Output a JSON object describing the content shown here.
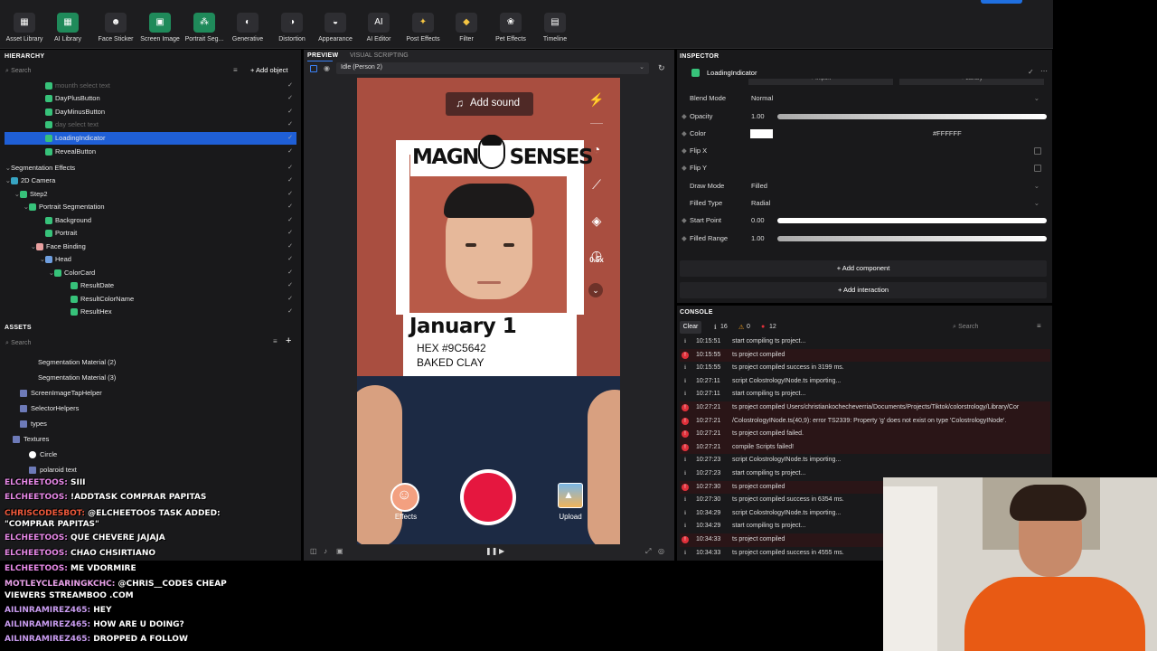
{
  "toolbar": {
    "items": [
      {
        "label": "Asset Library",
        "icon": "folder-icon"
      },
      {
        "label": "AI Library",
        "icon": "grid-icon"
      },
      {
        "label": "Face Sticker",
        "icon": "face-sticker-icon"
      },
      {
        "label": "Screen Image",
        "icon": "image-icon"
      },
      {
        "label": "Portrait Seg...",
        "icon": "portrait-icon"
      },
      {
        "label": "Generative",
        "icon": "generative-icon"
      },
      {
        "label": "Distortion",
        "icon": "distortion-icon"
      },
      {
        "label": "Appearance",
        "icon": "appearance-icon"
      },
      {
        "label": "AI Editor",
        "icon": "ai-editor-icon"
      },
      {
        "label": "Post Effects",
        "icon": "sparkle-icon"
      },
      {
        "label": "Filter",
        "icon": "filter-icon"
      },
      {
        "label": "Pet Effects",
        "icon": "paw-icon"
      },
      {
        "label": "Timeline",
        "icon": "timeline-icon"
      }
    ]
  },
  "hierarchy": {
    "title": "HIERARCHY",
    "search_placeholder": "Search",
    "add_object": "+ Add object",
    "rows": [
      {
        "label": "mounth select text",
        "dim": true
      },
      {
        "label": "DayPlusButton"
      },
      {
        "label": "DayMinusButton"
      },
      {
        "label": "day select text",
        "dim": true
      },
      {
        "label": "LoadingIndicator",
        "selected": true
      },
      {
        "label": "RevealButton"
      },
      {
        "label": "Segmentation Effects"
      },
      {
        "label": "2D Camera"
      },
      {
        "label": "Step2"
      },
      {
        "label": "Portrait Segmentation"
      },
      {
        "label": "Background"
      },
      {
        "label": "Portrait"
      },
      {
        "label": "Face Binding"
      },
      {
        "label": "Head"
      },
      {
        "label": "ColorCard"
      },
      {
        "label": "ResultDate"
      },
      {
        "label": "ResultColorName"
      },
      {
        "label": "ResultHex"
      }
    ]
  },
  "assets": {
    "title": "ASSETS",
    "search_placeholder": "Search",
    "rows": [
      "Segmentation Material (2)",
      "Segmentation Material (3)",
      "ScreenImageTapHelper",
      "SelectorHelpers",
      "types",
      "Textures",
      "Circle",
      "polaroid text"
    ]
  },
  "preview": {
    "tab_preview": "PREVIEW",
    "tab_visual": "VISUAL SCRIPTING",
    "person_select": "Idle (Person 2)",
    "add_sound": "Add sound",
    "brand_text": "MAGNIFI SENSES",
    "card_date": "January 1",
    "card_hex": "HEX #9C5642",
    "card_name": "BAKED CLAY",
    "effects_label": "Effects",
    "upload_label": "Upload",
    "zoom_label": "0.5x",
    "bg_color": "#a94e40"
  },
  "inspector": {
    "title": "INSPECTOR",
    "component_name": "LoadingIndicator",
    "import_label": "+ Import",
    "library_label": "+ Library",
    "blend_mode_label": "Blend Mode",
    "blend_mode_value": "Normal",
    "opacity_label": "Opacity",
    "opacity_value": "1.00",
    "color_label": "Color",
    "color_value": "#FFFFFF",
    "flipx_label": "Flip X",
    "flipy_label": "Flip Y",
    "draw_mode_label": "Draw Mode",
    "draw_mode_value": "Filled",
    "filled_type_label": "Filled Type",
    "filled_type_value": "Radial",
    "start_point_label": "Start Point",
    "start_point_value": "0.00",
    "filled_range_label": "Filled Range",
    "filled_range_value": "1.00",
    "add_component": "Add component",
    "add_interaction": "Add interaction"
  },
  "console": {
    "title": "CONSOLE",
    "clear": "Clear",
    "info_count": "16",
    "warn_count": "0",
    "err_count": "12",
    "search_placeholder": "Search",
    "rows": [
      {
        "t": "10:15:51",
        "m": "start compiling ts project...",
        "e": false
      },
      {
        "t": "10:15:55",
        "m": "ts project compiled",
        "e": true
      },
      {
        "t": "10:15:55",
        "m": "ts project compiled success in 3199 ms.",
        "e": false
      },
      {
        "t": "10:27:11",
        "m": "script ColostrologyINode.ts importing...",
        "e": false
      },
      {
        "t": "10:27:11",
        "m": "start compiling ts project...",
        "e": false
      },
      {
        "t": "10:27:21",
        "m": "ts project compiled Users/christiankochecheverria/Documents/Projects/Tiktok/colorstrology/Library/Cor",
        "e": true
      },
      {
        "t": "10:27:21",
        "m": "/ColostrologyINode.ts(40,9): error TS2339: Property 'g' does not exist on type 'ColostrologyINode'.",
        "e": true
      },
      {
        "t": "10:27:21",
        "m": "ts project compiled failed.",
        "e": true
      },
      {
        "t": "10:27:21",
        "m": "compile Scripts failed!",
        "e": true
      },
      {
        "t": "10:27:23",
        "m": "script ColostrologyINode.ts importing...",
        "e": false
      },
      {
        "t": "10:27:23",
        "m": "start compiling ts project...",
        "e": false
      },
      {
        "t": "10:27:30",
        "m": "ts project compiled",
        "e": true
      },
      {
        "t": "10:27:30",
        "m": "ts project compiled success in 6354 ms.",
        "e": false
      },
      {
        "t": "10:34:29",
        "m": "script ColostrologyINode.ts importing...",
        "e": false
      },
      {
        "t": "10:34:29",
        "m": "start compiling ts project...",
        "e": false
      },
      {
        "t": "10:34:33",
        "m": "ts project compiled",
        "e": true
      },
      {
        "t": "10:34:33",
        "m": "ts project compiled success in 4555 ms.",
        "e": false
      }
    ]
  },
  "chat": {
    "lines": [
      {
        "name": "ELCHEETOOS:",
        "text": "SIII"
      },
      {
        "name": "ELCHEETOOS:",
        "text": "!ADDTASK COMPRAR PAPITAS"
      },
      {
        "name": "CHRISCODESBOT:",
        "text": "@ELCHEETOOS TASK ADDED:"
      },
      {
        "name": "",
        "text": "\"COMPRAR PAPITAS\""
      },
      {
        "name": "ELCHEETOOS:",
        "text": "QUE CHEVERE JAJAJA"
      },
      {
        "name": "ELCHEETOOS:",
        "text": "CHAO CHSIRTIANO"
      },
      {
        "name": "ELCHEETOOS:",
        "text": "ME VDORMIRE"
      },
      {
        "name": "MOTLEYCLEARINGKCHC:",
        "text": "@CHRIS__CODES CHEAP"
      },
      {
        "name": "",
        "text": "VIEWERS STREAMBOO .COM"
      },
      {
        "name": "AILINRAMIREZ465:",
        "text": "HEY"
      },
      {
        "name": "AILINRAMIREZ465:",
        "text": "HOW ARE U DOING?"
      },
      {
        "name": "AILINRAMIREZ465:",
        "text": "DROPPED A FOLLOW"
      }
    ]
  }
}
